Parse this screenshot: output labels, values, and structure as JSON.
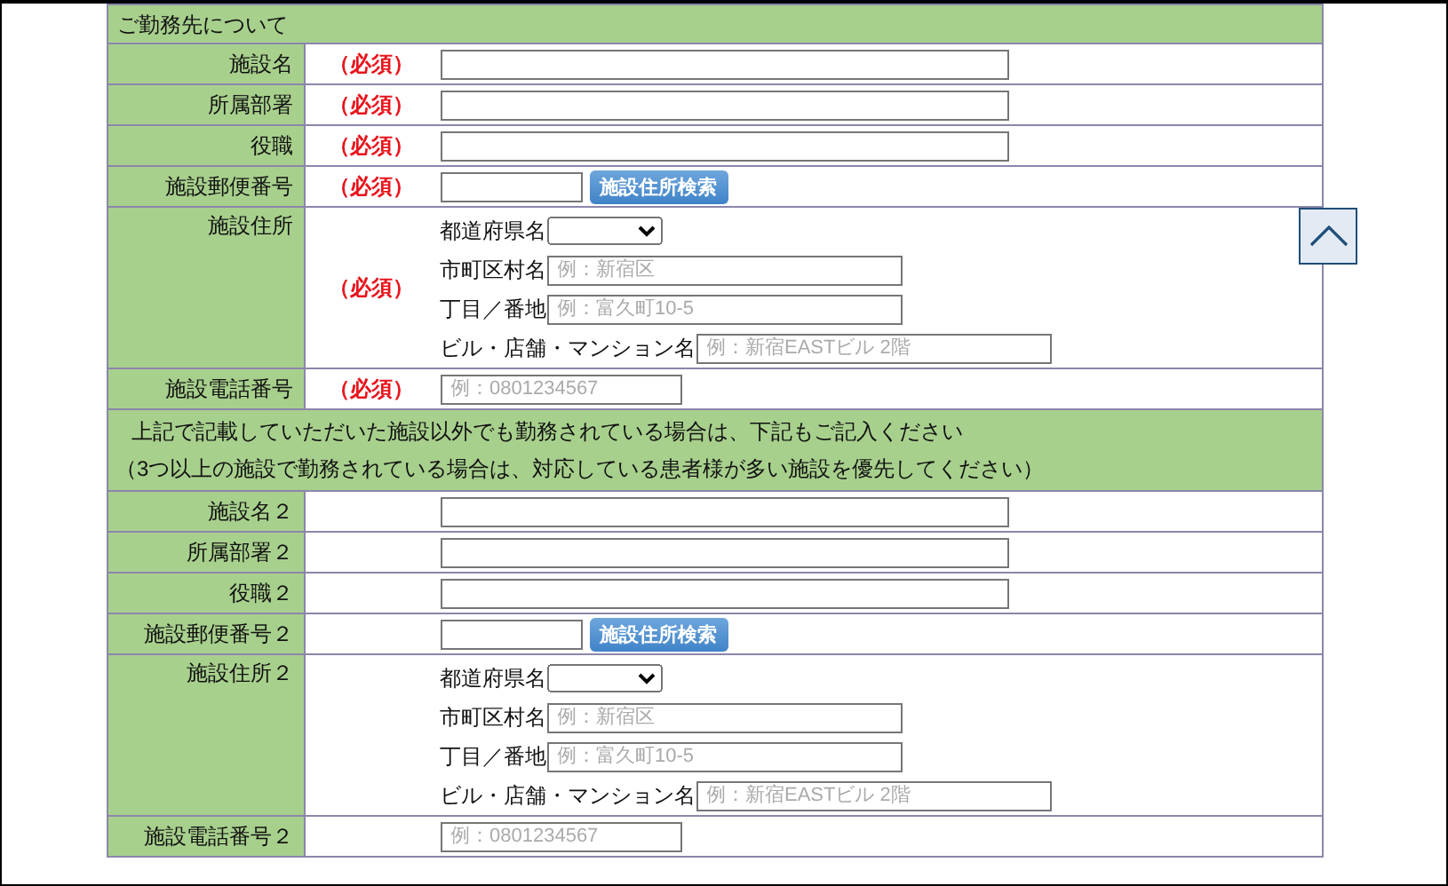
{
  "section_title": "ご勤務先について",
  "rows": [
    {
      "kind": "text",
      "label": "施設名",
      "required": "（必須）"
    },
    {
      "kind": "text",
      "label": "所属部署",
      "required": "（必須）"
    },
    {
      "kind": "text",
      "label": "役職",
      "required": "（必須）"
    },
    {
      "kind": "postal",
      "label": "施設郵便番号",
      "required": "（必須）",
      "button": "施設住所検索"
    },
    {
      "kind": "address",
      "label": "施設住所",
      "required": "（必須）",
      "fields": [
        {
          "kind": "select",
          "label": "都道府県名"
        },
        {
          "kind": "input",
          "label": "市町区村名",
          "placeholder": "例：新宿区"
        },
        {
          "kind": "input",
          "label": "丁目／番地",
          "placeholder": "例：富久町10-5"
        },
        {
          "kind": "input",
          "label": "ビル・店舗・マンション名",
          "placeholder": "例：新宿EASTビル 2階"
        }
      ]
    },
    {
      "kind": "phone",
      "label": "施設電話番号",
      "required": "（必須）",
      "placeholder": "例：0801234567"
    },
    {
      "kind": "notice",
      "lines": [
        "上記で記載していただいた施設以外でも勤務されている場合は、下記もご記入ください",
        "（3つ以上の施設で勤務されている場合は、対応している患者様が多い施設を優先してください）"
      ]
    },
    {
      "kind": "text",
      "label": "施設名２"
    },
    {
      "kind": "text",
      "label": "所属部署２"
    },
    {
      "kind": "text",
      "label": "役職２"
    },
    {
      "kind": "postal",
      "label": "施設郵便番号２",
      "button": "施設住所検索"
    },
    {
      "kind": "address",
      "label": "施設住所２",
      "fields": [
        {
          "kind": "select",
          "label": "都道府県名"
        },
        {
          "kind": "input",
          "label": "市町区村名",
          "placeholder": "例：新宿区"
        },
        {
          "kind": "input",
          "label": "丁目／番地",
          "placeholder": "例：富久町10-5"
        },
        {
          "kind": "input",
          "label": "ビル・店舗・マンション名",
          "placeholder": "例：新宿EASTビル 2階"
        }
      ]
    },
    {
      "kind": "phone",
      "label": "施設電話番号２",
      "placeholder": "例：0801234567"
    }
  ]
}
